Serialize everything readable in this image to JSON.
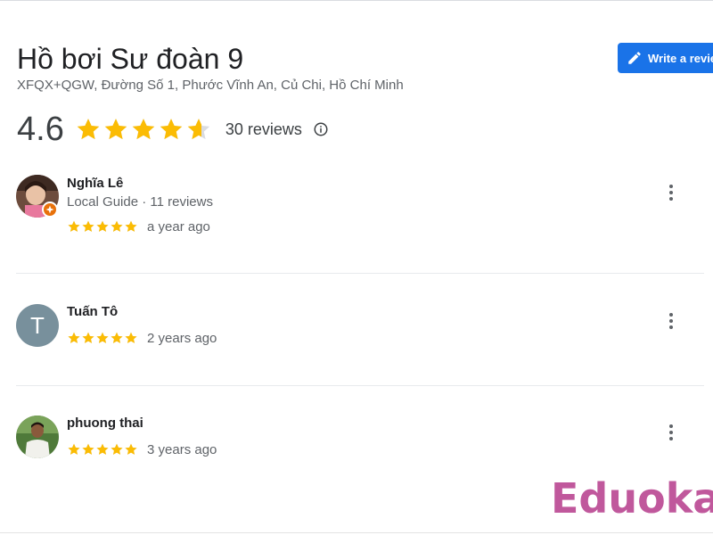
{
  "place": {
    "title": "Hồ bơi Sư đoàn 9",
    "address": "XFQX+QGW, Đường Số 1, Phước Vĩnh An, Củ Chi, Hồ Chí Minh",
    "rating": "4.6",
    "rating_value": 4.6,
    "review_count": "30 reviews"
  },
  "actions": {
    "write_review_label": "Write a review",
    "write_review_icon": "pencil-icon",
    "info_icon": "info-icon"
  },
  "reviews": [
    {
      "name": "Nghĩa Lê",
      "meta": "Local Guide · 11 reviews",
      "stars": 5,
      "date": "a year ago",
      "avatar": "photo",
      "local_guide": true
    },
    {
      "name": "Tuấn Tô",
      "meta": "",
      "stars": 5,
      "date": "2 years ago",
      "avatar": "letter",
      "avatar_letter": "T",
      "local_guide": false
    },
    {
      "name": "phuong thai",
      "meta": "",
      "stars": 5,
      "date": "3 years ago",
      "avatar": "photo",
      "local_guide": false
    }
  ],
  "watermark": "Eduoka",
  "colors": {
    "star": "#fbbc04",
    "accent": "#1a73e8",
    "watermark": "#c0589c",
    "avatar_letter_bg": "#78909c"
  }
}
